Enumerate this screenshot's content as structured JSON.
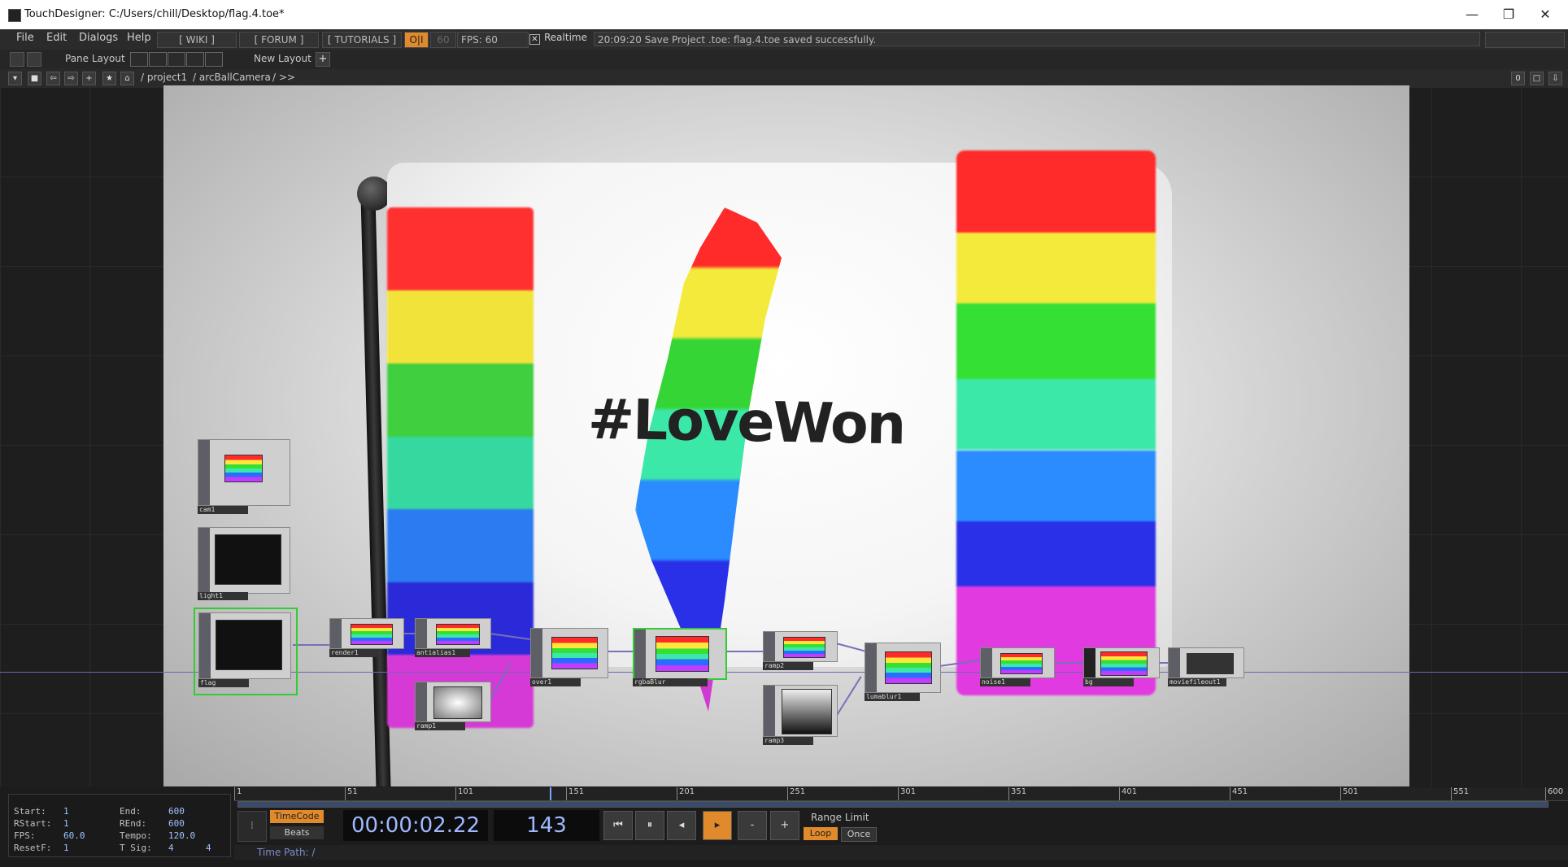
{
  "window": {
    "title": "TouchDesigner: C:/Users/chill/Desktop/flag.4.toe*"
  },
  "menu": {
    "file": "File",
    "edit": "Edit",
    "dialogs": "Dialogs",
    "help": "Help",
    "wiki": "[ WIKI ]",
    "forum": "[ FORUM ]",
    "tutorials": "[ TUTORIALS ]",
    "oi": "O|I",
    "fps_cap": "60",
    "fps": "FPS: 60",
    "realtime": "Realtime",
    "status": "20:09:20 Save Project .toe: flag.4.toe saved successfully."
  },
  "toolbar": {
    "pane_layout": "Pane Layout",
    "new_layout": "New Layout"
  },
  "path": {
    "project": "/ project1",
    "camera": "/ arcBallCamera",
    "more": "/ >>",
    "count": "0"
  },
  "viewer": {
    "hashtag": "#LoveWon"
  },
  "nodes": {
    "cam1": "cam1",
    "light1": "light1",
    "flag": "flag",
    "render1": "render1",
    "antialias1": "antialias1",
    "over1": "over1",
    "rgbablur": "rgbaBlur",
    "ramp1": "ramp1",
    "ramp2": "ramp2",
    "ramp3": "ramp3",
    "lumablur1": "lumablur1",
    "noise1": "noise1",
    "bg": "bg",
    "moviefileout1": "moviefileout1"
  },
  "timeline": {
    "start_label": "Start:",
    "start": "1",
    "end_label": "End:",
    "end": "600",
    "rstart_label": "RStart:",
    "rstart": "1",
    "rend_label": "REnd:",
    "rend": "600",
    "fps_label": "FPS:",
    "fps": "60.0",
    "tempo_label": "Tempo:",
    "tempo": "120.0",
    "resetf_label": "ResetF:",
    "resetf": "1",
    "tsig_label": "T Sig:",
    "tsig_a": "4",
    "tsig_b": "4",
    "ticks": [
      "1",
      "51",
      "101",
      "151",
      "201",
      "251",
      "301",
      "351",
      "401",
      "451",
      "501",
      "551",
      "600"
    ],
    "timecode_btn": "TimeCode",
    "beats_btn": "Beats",
    "timecode": "00:00:02.22",
    "frame": "143",
    "range_limit": "Range Limit",
    "loop": "Loop",
    "once": "Once",
    "timepath": "Time Path: /"
  },
  "colors": {
    "accent": "#e08a2c",
    "wire": "#7a6fb8",
    "selected": "#33cc33"
  }
}
